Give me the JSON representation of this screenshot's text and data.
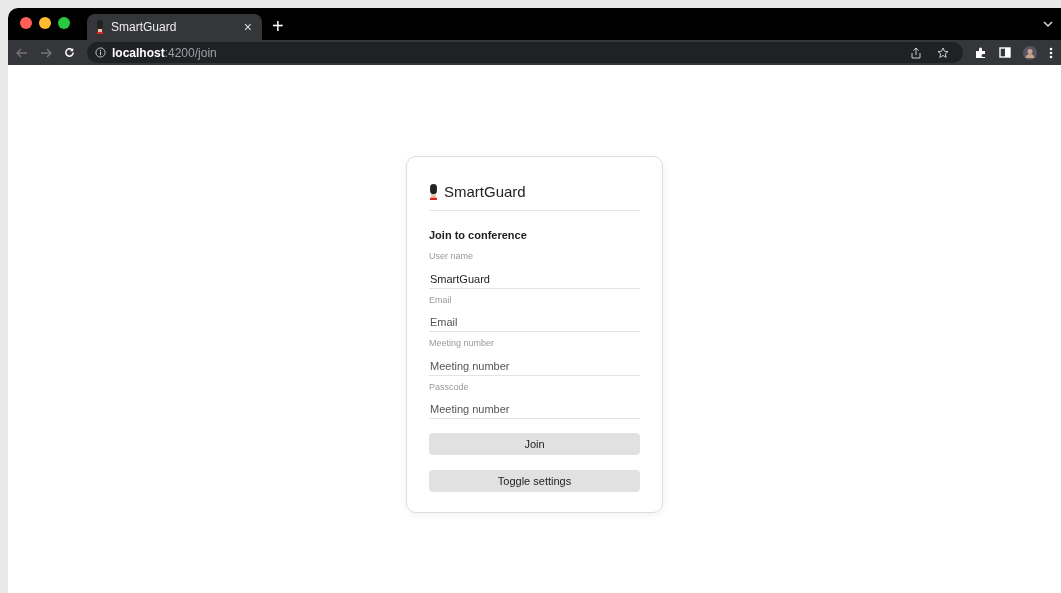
{
  "browser": {
    "tab_title": "SmartGuard",
    "tab_close": "×",
    "new_tab": "+",
    "address": "**localhost**:4200/join"
  },
  "card": {
    "brand": "SmartGuard",
    "heading": "Join to conference",
    "fields": [
      {
        "label": "User name",
        "value": "SmartGuard"
      },
      {
        "label": "Email",
        "placeholder": "Email"
      },
      {
        "label": "Meeting number",
        "placeholder": "Meeting number"
      },
      {
        "label": "Passcode",
        "placeholder": "Meeting number"
      }
    ],
    "buttons": [
      "Join",
      "Toggle settings"
    ]
  }
}
